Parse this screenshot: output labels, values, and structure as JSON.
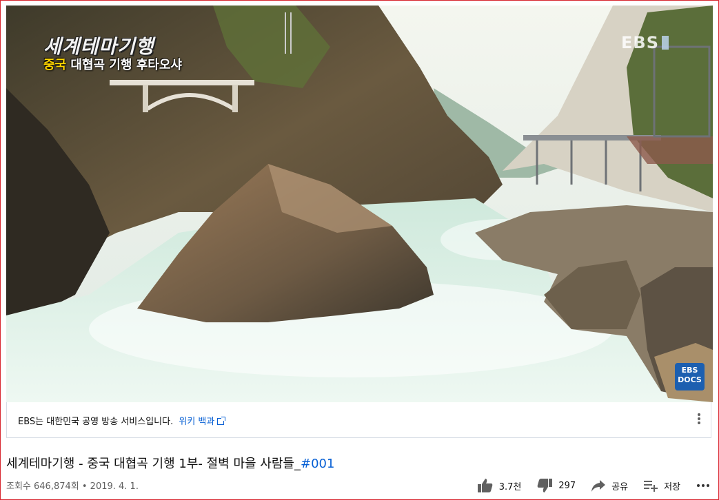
{
  "video": {
    "series_logo": "세계테마기행",
    "episode_highlight": "중국",
    "episode_rest": "대협곡 기행  후타오샤",
    "channel_watermark": "EBS",
    "docs_badge_top": "EBS",
    "docs_badge_bottom": "DOCS"
  },
  "info_panel": {
    "text": "EBS는 대한민국 공영 방송 서비스입니다.",
    "link_label": "위키 백과",
    "link_icon": "external-link-icon",
    "more_icon": "more-vert-icon"
  },
  "title": {
    "main": "세계테마기행 - 중국 대협곡 기행 1부- 절벽 마을 사람들_",
    "hashtag": "#001"
  },
  "meta": {
    "views": "조회수 646,874회",
    "separator": " • ",
    "date": "2019. 4. 1."
  },
  "actions": {
    "like_count": "3.7천",
    "dislike_count": "297",
    "share_label": "공유",
    "save_label": "저장"
  },
  "colors": {
    "link": "#065fd4",
    "frame_border": "#d7262e",
    "subtitle_highlight": "#ffd400"
  }
}
